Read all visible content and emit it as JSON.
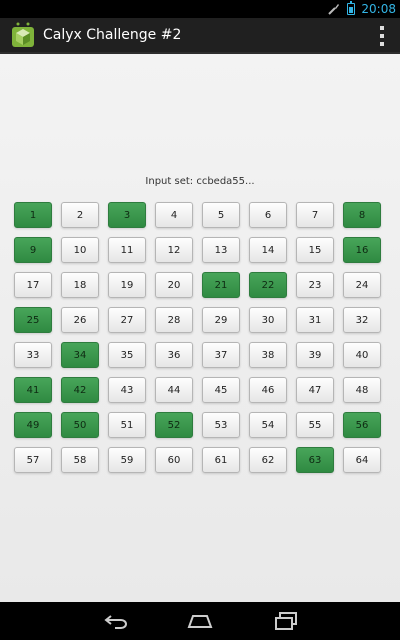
{
  "status_bar": {
    "time": "20:08"
  },
  "action_bar": {
    "title": "Calyx Challenge #2"
  },
  "main": {
    "input_set": "Input set: ccbeda55...",
    "cells": [
      {
        "label": "1",
        "on": true
      },
      {
        "label": "2",
        "on": false
      },
      {
        "label": "3",
        "on": true
      },
      {
        "label": "4",
        "on": false
      },
      {
        "label": "5",
        "on": false
      },
      {
        "label": "6",
        "on": false
      },
      {
        "label": "7",
        "on": false
      },
      {
        "label": "8",
        "on": true
      },
      {
        "label": "9",
        "on": true
      },
      {
        "label": "10",
        "on": false
      },
      {
        "label": "11",
        "on": false
      },
      {
        "label": "12",
        "on": false
      },
      {
        "label": "13",
        "on": false
      },
      {
        "label": "14",
        "on": false
      },
      {
        "label": "15",
        "on": false
      },
      {
        "label": "16",
        "on": true
      },
      {
        "label": "17",
        "on": false
      },
      {
        "label": "18",
        "on": false
      },
      {
        "label": "19",
        "on": false
      },
      {
        "label": "20",
        "on": false
      },
      {
        "label": "21",
        "on": true
      },
      {
        "label": "22",
        "on": true
      },
      {
        "label": "23",
        "on": false
      },
      {
        "label": "24",
        "on": false
      },
      {
        "label": "25",
        "on": true
      },
      {
        "label": "26",
        "on": false
      },
      {
        "label": "27",
        "on": false
      },
      {
        "label": "28",
        "on": false
      },
      {
        "label": "29",
        "on": false
      },
      {
        "label": "30",
        "on": false
      },
      {
        "label": "31",
        "on": false
      },
      {
        "label": "32",
        "on": false
      },
      {
        "label": "33",
        "on": false
      },
      {
        "label": "34",
        "on": true
      },
      {
        "label": "35",
        "on": false
      },
      {
        "label": "36",
        "on": false
      },
      {
        "label": "37",
        "on": false
      },
      {
        "label": "38",
        "on": false
      },
      {
        "label": "39",
        "on": false
      },
      {
        "label": "40",
        "on": false
      },
      {
        "label": "41",
        "on": true
      },
      {
        "label": "42",
        "on": true
      },
      {
        "label": "43",
        "on": false
      },
      {
        "label": "44",
        "on": false
      },
      {
        "label": "45",
        "on": false
      },
      {
        "label": "46",
        "on": false
      },
      {
        "label": "47",
        "on": false
      },
      {
        "label": "48",
        "on": false
      },
      {
        "label": "49",
        "on": true
      },
      {
        "label": "50",
        "on": true
      },
      {
        "label": "51",
        "on": false
      },
      {
        "label": "52",
        "on": true
      },
      {
        "label": "53",
        "on": false
      },
      {
        "label": "54",
        "on": false
      },
      {
        "label": "55",
        "on": false
      },
      {
        "label": "56",
        "on": true
      },
      {
        "label": "57",
        "on": false
      },
      {
        "label": "58",
        "on": false
      },
      {
        "label": "59",
        "on": false
      },
      {
        "label": "60",
        "on": false
      },
      {
        "label": "61",
        "on": false
      },
      {
        "label": "62",
        "on": false
      },
      {
        "label": "63",
        "on": true
      },
      {
        "label": "64",
        "on": false
      }
    ]
  },
  "icons": {
    "status_left": "tool-icon",
    "battery": "battery-icon",
    "logo": "android-logo-icon",
    "overflow": "overflow-menu-icon",
    "nav": [
      "back-icon",
      "home-icon",
      "recent-apps-icon"
    ]
  },
  "colors": {
    "accent": "#33b5e5",
    "selected_cell": "#3b9a4e",
    "action_bar": "#202020"
  }
}
